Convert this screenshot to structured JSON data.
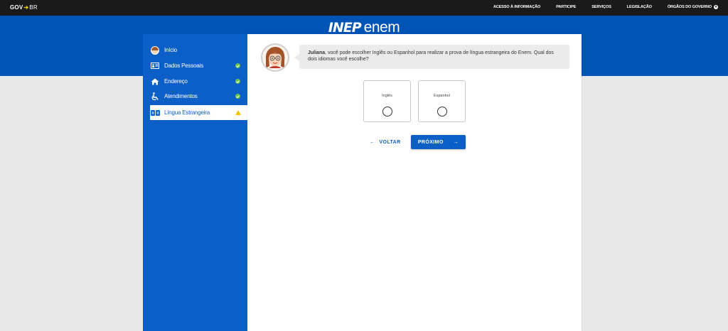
{
  "govbar": {
    "brand_gov": "GOV",
    "brand_br": "BR",
    "links": [
      "ACESSO À INFORMAÇÃO",
      "PARTICIPE",
      "SERVIÇOS",
      "LEGISLAÇÃO",
      "ÓRGÃOS DO GOVERNO"
    ]
  },
  "header": {
    "logo_inep": "INEP",
    "logo_enem": "enem"
  },
  "sidebar": {
    "items": [
      {
        "label": "Início",
        "icon": "user-avatar-icon",
        "status": "none"
      },
      {
        "label": "Dados Pessoais",
        "icon": "id-card-icon",
        "status": "complete"
      },
      {
        "label": "Endereço",
        "icon": "home-icon",
        "status": "complete"
      },
      {
        "label": "Atendimentos",
        "icon": "wheelchair-icon",
        "status": "complete"
      },
      {
        "label": "Língua Estrangeira",
        "icon": "language-icon",
        "status": "warning"
      }
    ]
  },
  "assistant": {
    "name": "Juliana",
    "message": ", você pode escolher Inglês ou Espanhol para realizar a prova de língua estrangeira do Enem. Qual dos dois idiomas você escolhe?"
  },
  "choices": [
    {
      "label": "Inglês",
      "selected": false
    },
    {
      "label": "Espanhol",
      "selected": false
    }
  ],
  "actions": {
    "back_label": "VOLTAR",
    "next_label": "PRÓXIMO"
  },
  "colors": {
    "brand_blue": "#0054b6",
    "sidebar_blue": "#0c5fc7",
    "check_green": "#6cc24a",
    "warning_yellow": "#f5c400"
  }
}
